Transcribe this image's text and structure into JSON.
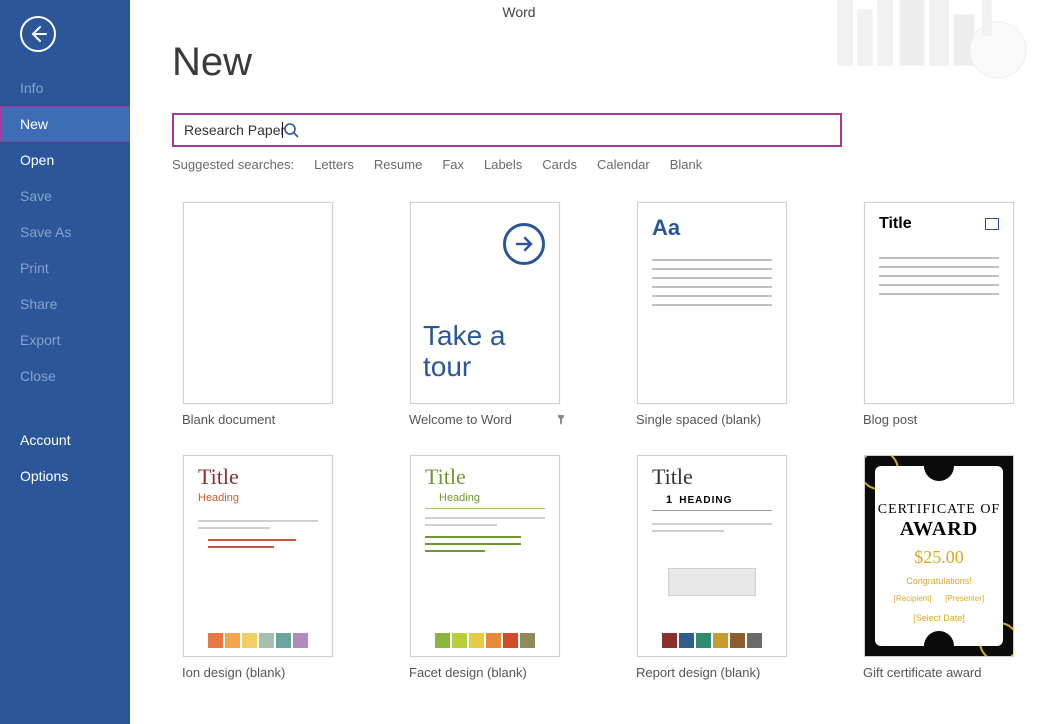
{
  "app_title": "Word",
  "sidebar": {
    "items": [
      {
        "label": "Info",
        "dim": true
      },
      {
        "label": "New",
        "dim": false,
        "selected": true
      },
      {
        "label": "Open",
        "dim": false
      },
      {
        "label": "Save",
        "dim": true
      },
      {
        "label": "Save As",
        "dim": true
      },
      {
        "label": "Print",
        "dim": true
      },
      {
        "label": "Share",
        "dim": true
      },
      {
        "label": "Export",
        "dim": true
      },
      {
        "label": "Close",
        "dim": true
      }
    ],
    "account_label": "Account",
    "options_label": "Options"
  },
  "page_title": "New",
  "search": {
    "value": "Research Paper",
    "icon": "search-icon"
  },
  "suggested": {
    "label": "Suggested searches:",
    "items": [
      "Letters",
      "Resume",
      "Fax",
      "Labels",
      "Cards",
      "Calendar",
      "Blank"
    ]
  },
  "templates": [
    {
      "label": "Blank document",
      "kind": "blank"
    },
    {
      "label": "Welcome to Word",
      "kind": "tour",
      "pinned": true,
      "tour_line1": "Take a",
      "tour_line2": "tour"
    },
    {
      "label": "Single spaced (blank)",
      "kind": "single",
      "aa": "Aa"
    },
    {
      "label": "Blog post",
      "kind": "blog",
      "title_text": "Title"
    },
    {
      "label": "Ion design (blank)",
      "kind": "ion",
      "title_text": "Title",
      "heading_text": "Heading",
      "palette": [
        "#e97742",
        "#f2a64d",
        "#f1ce6a",
        "#a6bfae",
        "#6aa5a0",
        "#b18bc0"
      ]
    },
    {
      "label": "Facet design (blank)",
      "kind": "facet",
      "title_text": "Title",
      "heading_text": "Heading",
      "palette": [
        "#8bb53c",
        "#b7cf3b",
        "#e2ce45",
        "#e98a38",
        "#d14b2a",
        "#8f8a5a"
      ]
    },
    {
      "label": "Report design (blank)",
      "kind": "report",
      "title_text": "Title",
      "heading_num": "1",
      "heading_text": "Heading",
      "palette": [
        "#8c2f2f",
        "#2f5e8c",
        "#2f8c6c",
        "#c99b2f",
        "#8c5e2f",
        "#6b6b6b"
      ]
    },
    {
      "label": "Gift certificate award",
      "kind": "cert",
      "line1": "CERTIFICATE OF",
      "line2": "AWARD",
      "line3": "$25.00",
      "line4": "Congratulations!",
      "badge1": "[Recipient]",
      "badge2": "[Presenter]",
      "line5": "[Select Date]"
    }
  ]
}
